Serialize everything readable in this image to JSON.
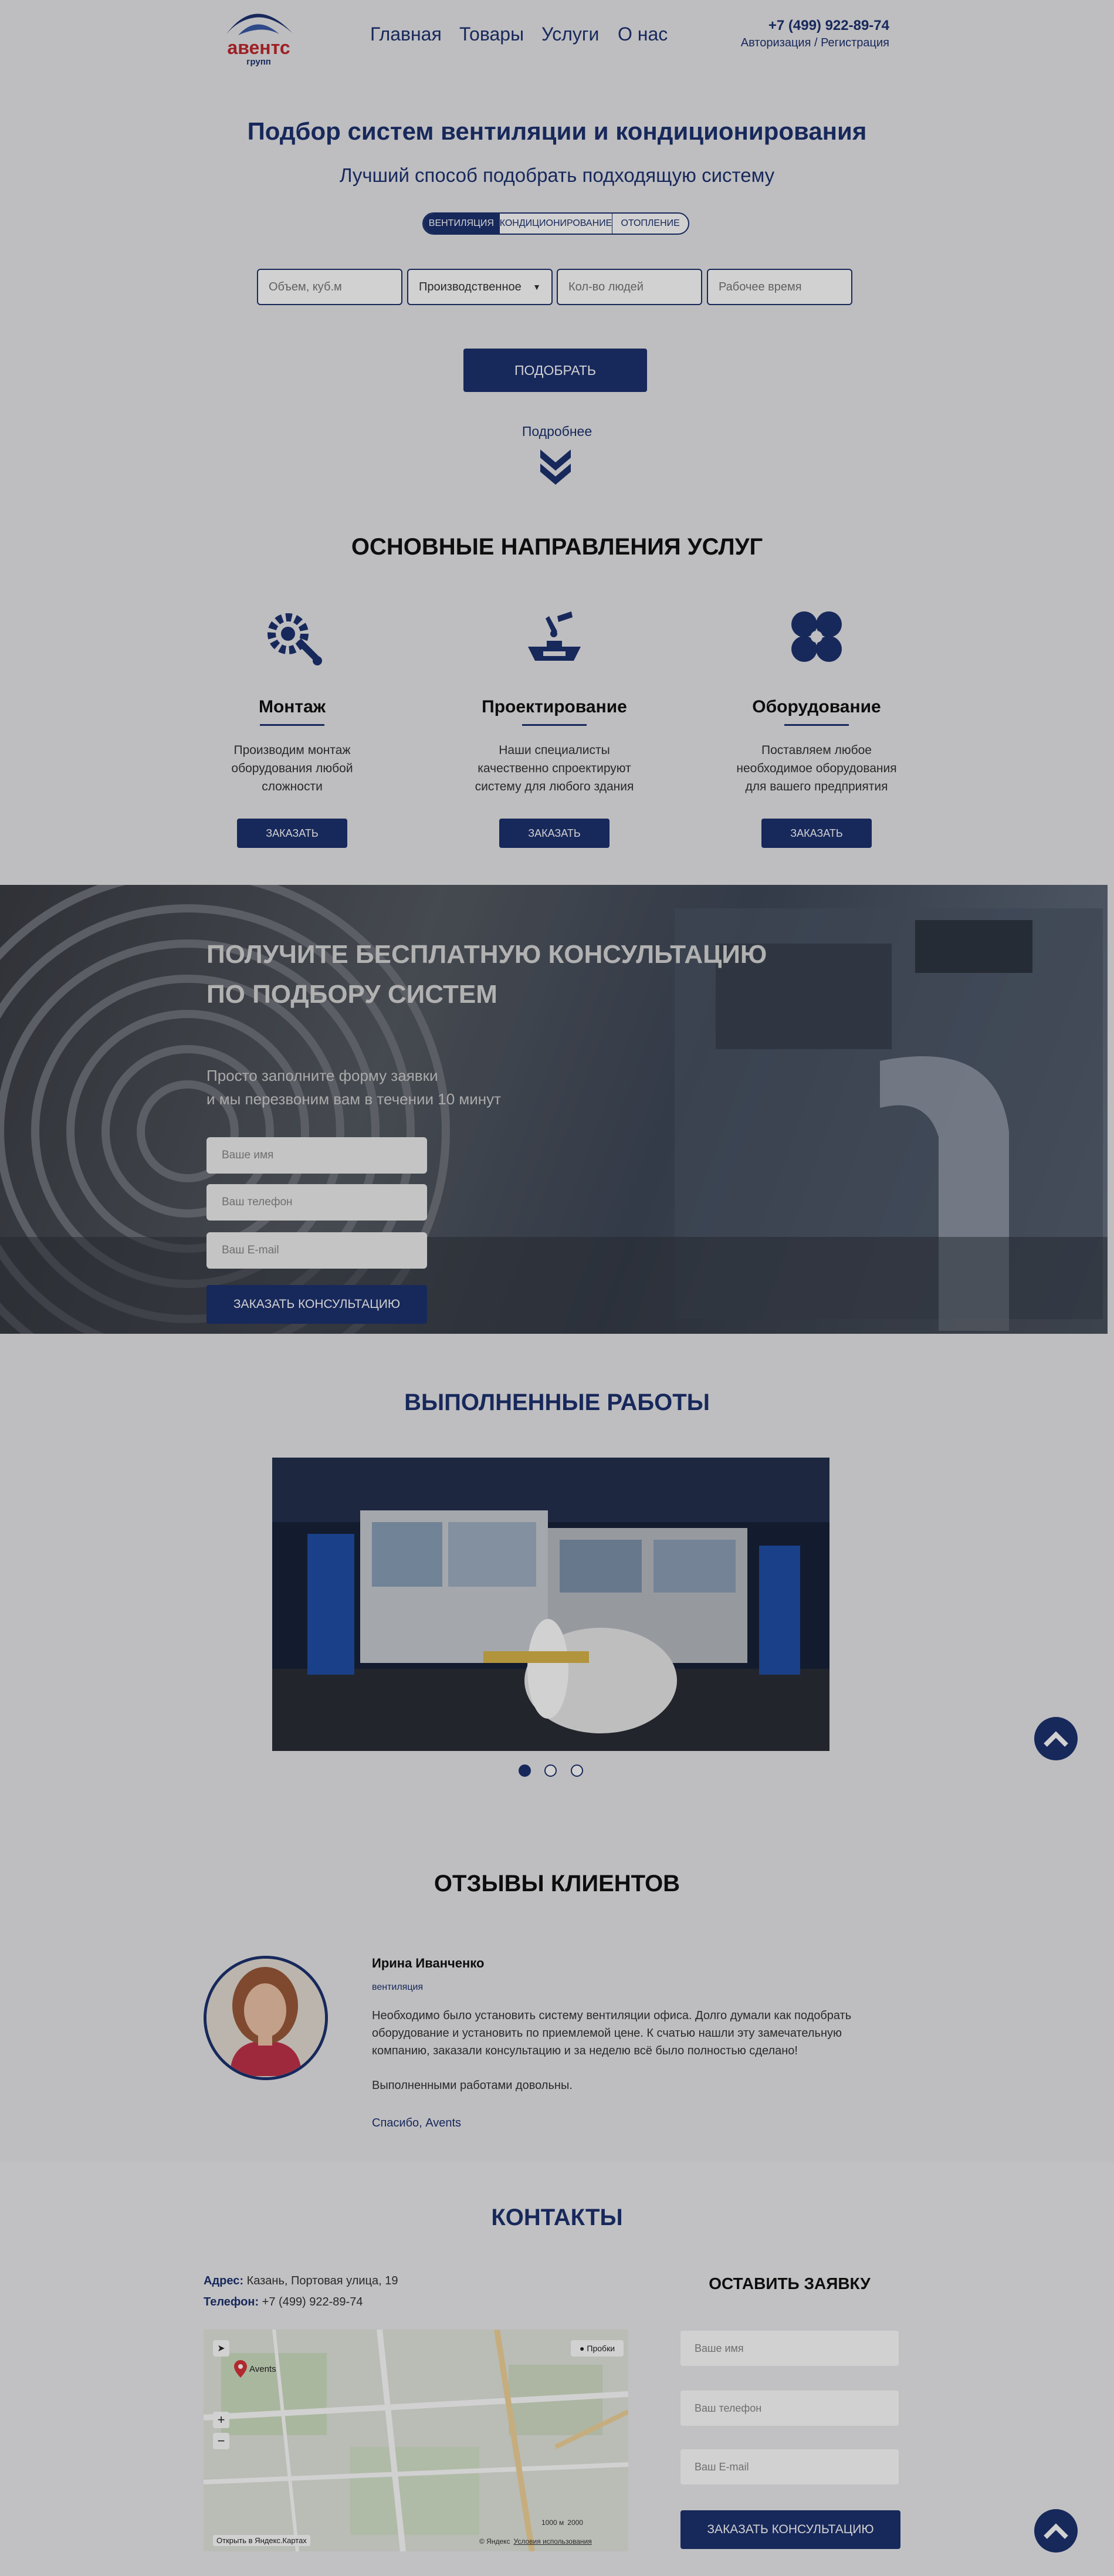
{
  "header": {
    "logo_text": "авентс",
    "logo_sub": "групп",
    "nav": [
      "Главная",
      "Товары",
      "Услуги",
      "О нас"
    ],
    "phone": "+7 (499) 922-89-74",
    "auth": "Авторизация / Регистрация"
  },
  "hero": {
    "title": "Подбор систем вентиляции и кондиционирования",
    "subtitle": "Лучший способ подобрать подходящую систему",
    "tabs": [
      "ВЕНТИЛЯЦИЯ",
      "КОНДИЦИОНИРОВАНИЕ",
      "ОТОПЛЕНИЕ"
    ],
    "active_tab": 0,
    "fields": {
      "volume_placeholder": "Объем, куб.м",
      "type_value": "Производственное",
      "people_placeholder": "Кол-во людей",
      "hours_placeholder": "Рабочее время"
    },
    "button": "ПОДОБРАТЬ",
    "more": "Подробнее"
  },
  "services": {
    "title": "ОСНОВНЫЕ НАПРАВЛЕНИЯ УСЛУГ",
    "items": [
      {
        "name": "Монтаж",
        "desc": "Производим монтаж оборудования любой сложности",
        "button": "ЗАКАЗАТЬ",
        "icon": "wrench-gear-icon"
      },
      {
        "name": "Проектирование",
        "desc": "Наши специалисты качественно спроектируют систему для любого здания",
        "button": "ЗАКАЗАТЬ",
        "icon": "drafting-table-icon"
      },
      {
        "name": "Оборудование",
        "desc": "Поставляем любое необходимое оборудования для вашего предприятия",
        "button": "ЗАКАЗАТЬ",
        "icon": "fan-icon"
      }
    ]
  },
  "consult": {
    "title_line1": "ПОЛУЧИТЕ БЕСПЛАТНУЮ КОНСУЛЬТАЦИЮ",
    "title_line2": "ПО ПОДБОРУ СИСТЕМ",
    "sub_line1": "Просто заполните форму заявки",
    "sub_line2": "и мы перезвоним вам в течении 10 минут",
    "name_placeholder": "Ваше имя",
    "phone_placeholder": "Ваш телефон",
    "email_placeholder": "Ваш E-mail",
    "button": "ЗАКАЗАТЬ КОНСУЛЬТАЦИЮ"
  },
  "works": {
    "title": "ВЫПОЛНЕННЫЕ РАБОТЫ",
    "slide_count": 3,
    "active_slide": 0
  },
  "reviews": {
    "title": "ОТЗЫВЫ КЛИЕНТОВ",
    "name": "Ирина Иванченко",
    "role": "вентиляция",
    "text": "Необходимо было установить систему вентиляции офиса. Долго думали как подобрать оборудование и установить по приемлемой цене. К счатью нашли эту замечательную компанию, заказали консультацию и за неделю всё было полностью сделано!",
    "text2": "Выполненными работами довольны.",
    "sign": "Спасибо, Avents"
  },
  "contacts": {
    "title": "КОНТАКТЫ",
    "addr_label": "Адрес:",
    "addr_value": "Казань, Портовая улица, 19",
    "tel_label": "Телефон:",
    "tel_value": "+7 (499) 922-89-74",
    "map": {
      "marker_label": "Avents",
      "traffic": "Пробки",
      "open_link": "Открыть в Яндекс.Картах",
      "copyright": "© Яндекс",
      "terms": "Условия использования",
      "scale1": "1000 м",
      "scale2": "2000"
    },
    "order": {
      "title": "ОСТАВИТЬ ЗАЯВКУ",
      "name_placeholder": "Ваше имя",
      "phone_placeholder": "Ваш телефон",
      "email_placeholder": "Ваш E-mail",
      "button": "ЗАКАЗАТЬ КОНСУЛЬТАЦИЮ"
    }
  },
  "colors": {
    "brand": "#1d3170",
    "accent_red": "#c0282d"
  }
}
